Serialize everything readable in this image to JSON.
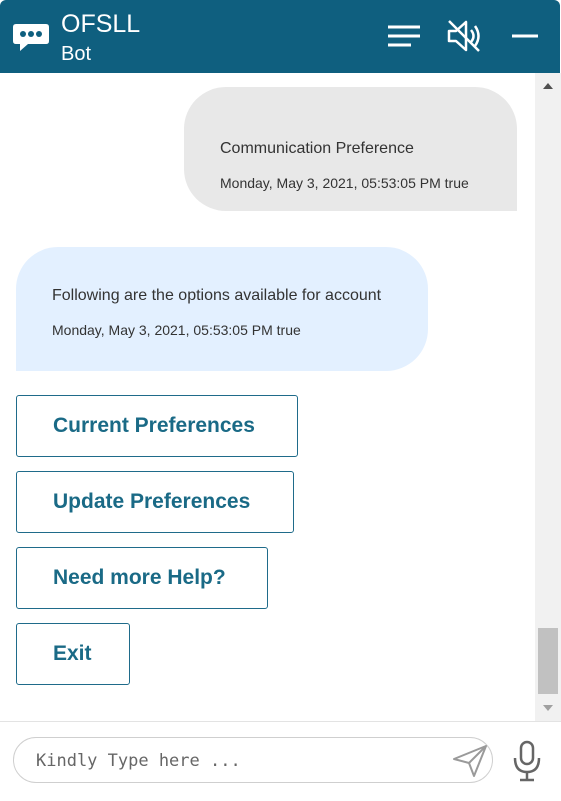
{
  "header": {
    "title": "OFSLL",
    "subtitle": "Bot",
    "bg_color": "#0f5f7f",
    "icons": [
      "chat-bubble-icon",
      "menu-icon",
      "speaker-muted-icon",
      "minimize-icon"
    ]
  },
  "messages": [
    {
      "from": "user",
      "text": "Communication Preference",
      "timestamp": "Monday, May 3, 2021, 05:53:05 PM true"
    },
    {
      "from": "bot",
      "text": "Following are the options available for account",
      "timestamp": "Monday, May 3, 2021, 05:53:05 PM true"
    }
  ],
  "options": [
    {
      "label": "Current Preferences"
    },
    {
      "label": "Update Preferences"
    },
    {
      "label": "Need more Help?"
    },
    {
      "label": "Exit"
    }
  ],
  "input": {
    "placeholder": "Kindly Type here ...",
    "value": ""
  },
  "colors": {
    "accent": "#1a6a86",
    "user_bubble": "#e8e8e8",
    "bot_bubble": "#e3f0ff"
  }
}
